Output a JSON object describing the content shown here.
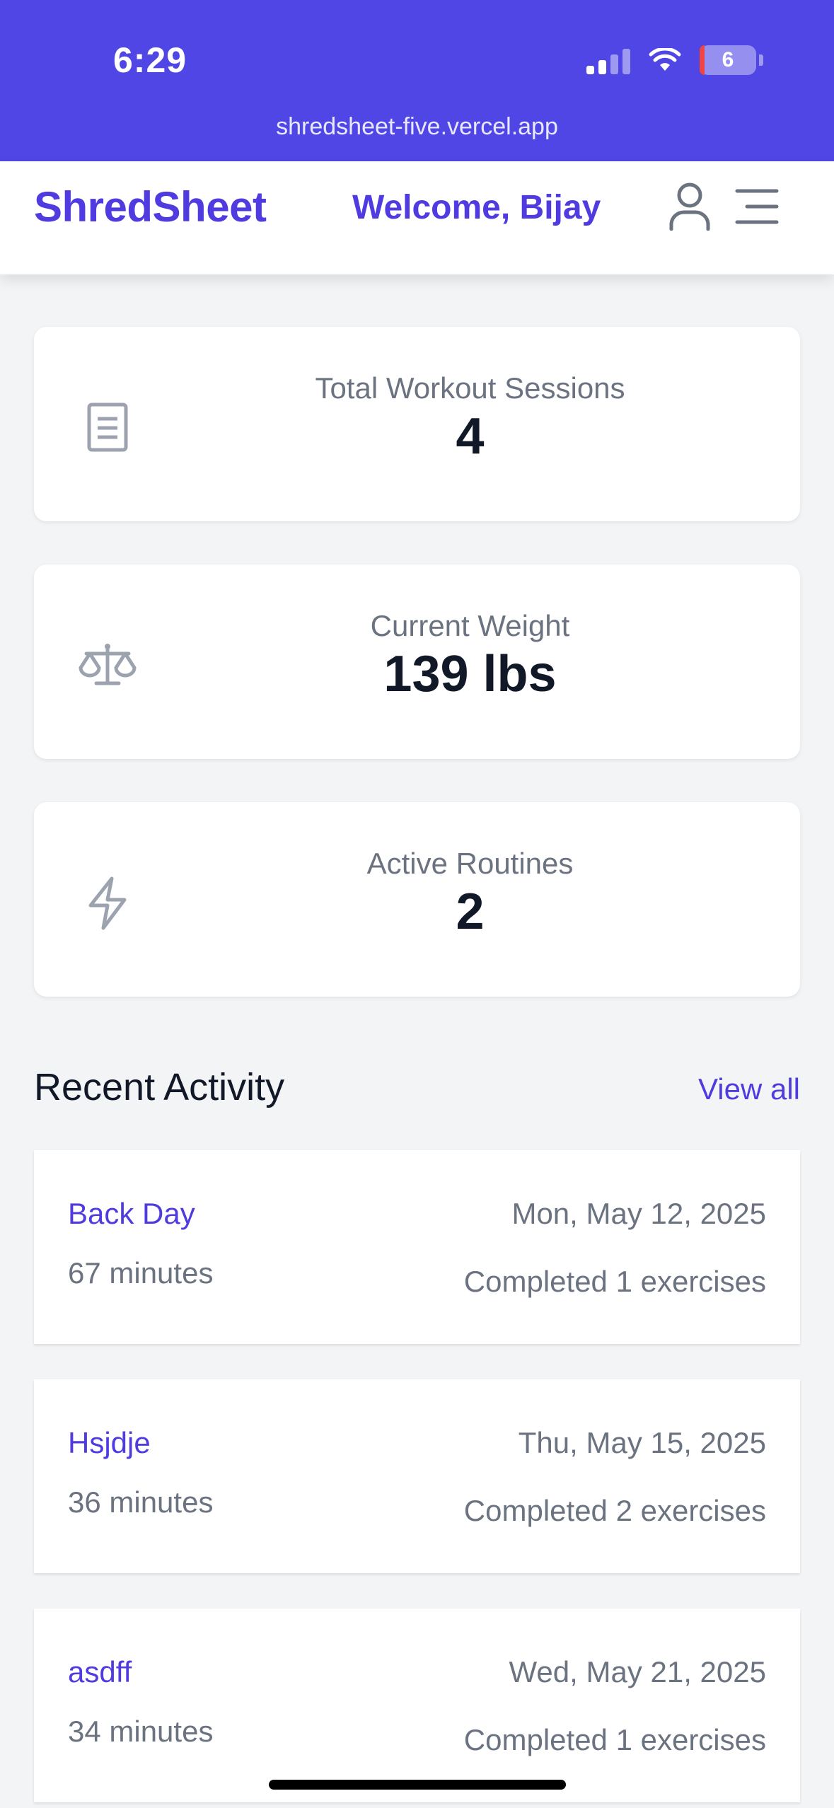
{
  "status_bar": {
    "time": "6:29",
    "battery": "6",
    "url": "shredsheet-five.vercel.app"
  },
  "header": {
    "brand": "ShredSheet",
    "welcome": "Welcome, Bijay",
    "user_icon": "user-icon",
    "menu_icon": "menu-icon"
  },
  "stats": [
    {
      "label": "Total Workout Sessions",
      "value": "4",
      "icon": "document-icon"
    },
    {
      "label": "Current Weight",
      "value": "139 lbs",
      "icon": "scale-icon"
    },
    {
      "label": "Active Routines",
      "value": "2",
      "icon": "bolt-icon"
    }
  ],
  "recent": {
    "title": "Recent Activity",
    "view_all": "View all",
    "items": [
      {
        "name": "Back Day",
        "duration": "67 minutes",
        "date": "Mon, May 12, 2025",
        "completed": "Completed 1 exercises"
      },
      {
        "name": "Hsjdje",
        "duration": "36 minutes",
        "date": "Thu, May 15, 2025",
        "completed": "Completed 2 exercises"
      },
      {
        "name": "asdff",
        "duration": "34 minutes",
        "date": "Wed, May 21, 2025",
        "completed": "Completed 1 exercises"
      }
    ]
  },
  "colors": {
    "accent": "#4f46e5",
    "brand_text": "#4f3be0",
    "background": "#f3f4f6"
  }
}
